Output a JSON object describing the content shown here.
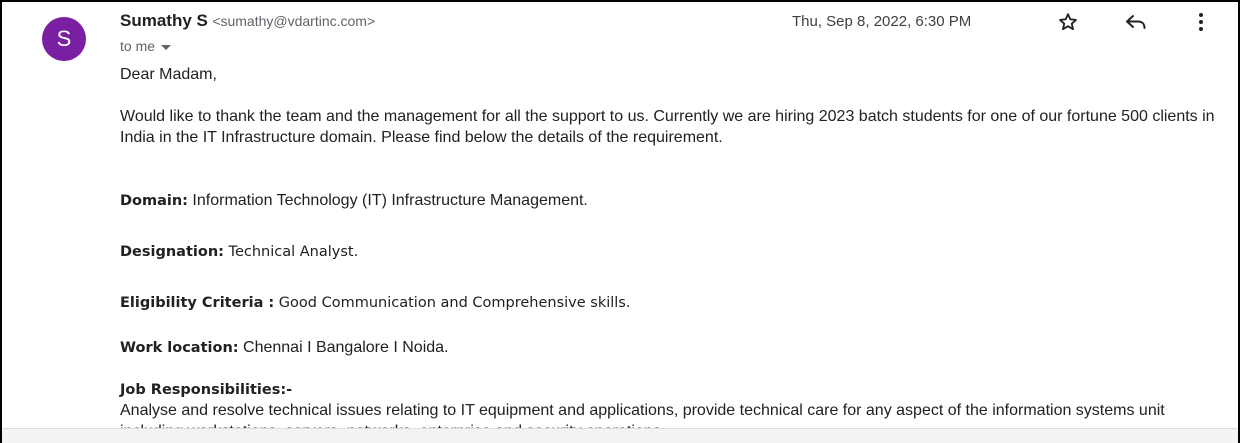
{
  "email": {
    "sender": {
      "avatar_letter": "S",
      "name": "Sumathy S",
      "email": "<sumathy@vdartinc.com>"
    },
    "recipient_label": "to me",
    "date": "Thu, Sep 8, 2022, 6:30 PM",
    "icons": {
      "star": "star-icon",
      "reply": "reply-icon",
      "more": "more-vert-icon"
    },
    "body": {
      "greeting": "Dear Madam,",
      "intro": "Would like to thank the team and the management for all the support to us. Currently we are hiring 2023 batch students for one of our fortune 500 clients in India in the IT Infrastructure domain. Please find below the details of the requirement.",
      "domain_label": "Domain:",
      "domain_value": " Information Technology (IT) Infrastructure Management.",
      "designation_label": "Designation:",
      "designation_value": " Technical Analyst.",
      "eligibility_label": "Eligibility Criteria :",
      "eligibility_value": " Good Communication and Comprehensive skills.",
      "location_label": "Work location:",
      "location_value": " Chennai I Bangalore I Noida.",
      "responsibilities_label": "Job Responsibilities:-",
      "responsibilities_text": "Analyse and resolve technical issues relating to IT equipment and applications, provide technical care for any aspect of the information systems unit including workstations, servers, networks, enterprise and security operations."
    }
  },
  "colors": {
    "avatar_bg": "#7b1fa2",
    "text_primary": "#202124",
    "text_secondary": "#5f6368"
  }
}
